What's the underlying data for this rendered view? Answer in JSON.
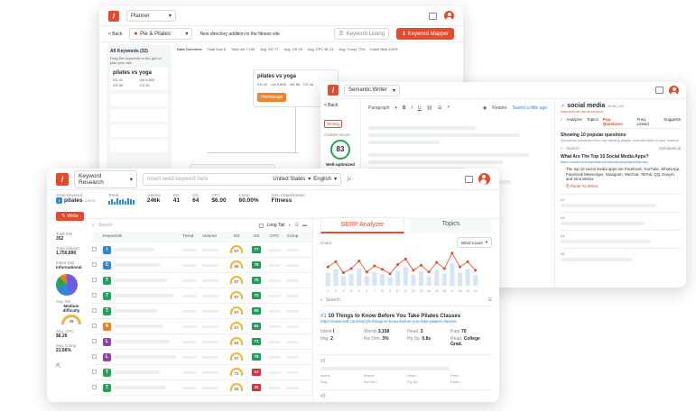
{
  "planner": {
    "app": "Planner",
    "breadcrumb_back": "< Back",
    "topic": "Pie & Pilates",
    "directory_note": "New directory addition to the fitness site",
    "listing_btn": "Keyword Listing",
    "mapper_btn": "Keyword Mapper",
    "all_keywords": "All Keywords (32)",
    "drag_hint": "Drag the keywords to the grid to plan your site",
    "card_title": "pilates vs yoga",
    "card_vals": [
      "KD 41",
      "Vol 9,800",
      "OS 50",
      "CS 10"
    ],
    "data_overview": "Data Overview",
    "stats": [
      "Total Kws 8",
      "Total Vol 7,195",
      "Avg. KD 77",
      "Avg. OS 25",
      "Avg. CPC $1.24",
      "Avg. Comp 72%",
      "Intent Bkts 100%"
    ],
    "node_title": "pilates vs yoga",
    "node_vals": [
      "KD 41",
      "Vol 9,800",
      "OS 50",
      "CS 10"
    ],
    "homepage_btn": "Homepage"
  },
  "writer": {
    "app": "Semantic Writer",
    "back": "< Back",
    "paragraph": "Paragraph",
    "reader": "Reader",
    "save": "Saved a little ago",
    "writing_badge": "Writing",
    "content_score_label": "Content Score",
    "score": "83",
    "score_status": "Well-optimized",
    "suggestions": "Suggestions",
    "word_count_label": "Word Count",
    "word_count": "501",
    "keyword": "social media",
    "keyword_meta": "46.6k | 83",
    "add_outline": "Add sets for the document",
    "side_tabs": [
      "Analyzer",
      "Topics",
      "Pop. Questions",
      "Freq. Linked",
      "Suggests"
    ],
    "active_tab": "Pop. Questions",
    "showing": "Showing 10 popular questions",
    "showing_sub": "Questions extracted from top-ranking pages, relevant titles in your content",
    "search_placeholder": "Search",
    "sort": "Alphabetical",
    "q_title": "What Are The Top 10 Social Media Apps?",
    "q_url": "https://www.investopedia.com/terms/s/socialmedia.asp",
    "q_body": "The top 10 social media apps are Facebook, YouTube, WhatsApp, Facebook Messenger, Instagram, WeChat, TikTok, QQ, Douyin, and Sina Weibo.",
    "paste": "Paste To Writer",
    "num1": "#1",
    "num2": "#2",
    "num3": "#3",
    "num4": "#4",
    "num5": "#5"
  },
  "kr": {
    "app": "Keyword Research",
    "search_placeholder": "Insert seed keyword here",
    "country": "United States",
    "language": "English",
    "seed_label": "Seed Keyword",
    "seed": "pilates",
    "seed_tag": "US/EN",
    "write_btn": "Write",
    "trend_label": "Trend",
    "volume_label": "Volume",
    "volume": "246k",
    "kd_label": "KD",
    "kd": "41",
    "os_label": "OS",
    "os": "64",
    "cpc_label": "CPC",
    "cpc": "$6.00",
    "comp_label": "Comp",
    "comp": "60.00%",
    "semclass_label": "Smt. Classification",
    "semclass": "Fitness",
    "total_kw_label": "Total KW",
    "total_kw": "352",
    "total_volume_label": "Total Volume",
    "total_volume": "1,750,890",
    "intent_label": "Intent Dist.",
    "intent": "Informational",
    "avg_kd_label": "Avg. KD",
    "avg_kd": "Medium difficulty",
    "avg_kd_val": "49",
    "avg_cpc_label": "Avg. CPC",
    "avg_cpc": "$6.26",
    "avg_comp_label": "Avg. Comp",
    "avg_comp": "21.66%",
    "search": "Search",
    "long_tail": "Long Tail",
    "cols": [
      "Keywords",
      "Trend",
      "Volume",
      "KD",
      "OS",
      "CPC",
      "Comp"
    ],
    "rows": [
      {
        "i": "I",
        "ic": "#2e86de",
        "kd": "57",
        "os": "77",
        "oc": "#1f9d55"
      },
      {
        "i": "C",
        "ic": "#2e86de",
        "kd": "58",
        "os": "78",
        "oc": "#1f9d55"
      },
      {
        "i": "T",
        "ic": "#22a559",
        "kd": "57",
        "os": "70",
        "oc": "#1f9d55"
      },
      {
        "i": "T",
        "ic": "#22a559",
        "kd": "57",
        "os": "72",
        "oc": "#1f9d55"
      },
      {
        "i": "T",
        "ic": "#22a559",
        "kd": "57",
        "os": "93",
        "oc": "#1f9d55"
      },
      {
        "i": "N",
        "ic": "#e67e22",
        "kd": "57",
        "os": "62",
        "oc": "#1f9d55"
      },
      {
        "i": "L",
        "ic": "#8e44ad",
        "kd": "54",
        "os": "71",
        "oc": "#1f9d55"
      },
      {
        "i": "L",
        "ic": "#8e44ad",
        "kd": "57",
        "os": "78",
        "oc": "#1f9d55"
      },
      {
        "i": "T",
        "ic": "#22a559",
        "kd": "72",
        "os": "14",
        "oc": "#d63031"
      },
      {
        "i": "T",
        "ic": "#22a559",
        "kd": "53",
        "os": "22",
        "oc": "#d63031"
      }
    ],
    "serp_tab": "SERP Analyzer",
    "topics_tab": "Topics",
    "count_label": "Count",
    "word_count_sel": "Word Count",
    "serp_search": "Search",
    "result_num": "#1",
    "result_title": "10 Things to Know Before You Take Pilates Classes",
    "result_url": "https://www.self.com/story/5-things-to-know-before-you-take-pilates-classes",
    "metrics": [
      {
        "l": "Intent",
        "v": "I"
      },
      {
        "l": "Words",
        "v": "3,158"
      },
      {
        "l": "Head.",
        "v": "3"
      },
      {
        "l": "Para",
        "v": "70"
      },
      {
        "l": "Img.",
        "v": "2"
      },
      {
        "l": "Kw Den.",
        "v": "3%"
      },
      {
        "l": "Pg Sp.",
        "v": "0.8s"
      },
      {
        "l": "Read.",
        "v": "College Grad."
      }
    ],
    "r2": "#2",
    "r3": "#3",
    "metric_labels": [
      "Intent",
      "Words",
      "Head.",
      "Para",
      "Img.",
      "Kw Den.",
      "Pg Sp.",
      "Read."
    ]
  },
  "chart_data": {
    "type": "line",
    "title": "",
    "ylabel": "Count",
    "x": [
      1,
      2,
      3,
      4,
      5,
      6,
      7,
      8,
      9,
      10,
      11,
      12,
      13,
      14,
      15,
      16,
      17,
      18,
      19,
      20
    ],
    "values": [
      55,
      70,
      38,
      50,
      72,
      40,
      58,
      48,
      35,
      62,
      78,
      45,
      60,
      40,
      68,
      50,
      95,
      55,
      70,
      45
    ],
    "ylim": [
      0,
      100
    ]
  },
  "colors": {
    "brand": "#e74a2b",
    "blue": "#2e86de"
  }
}
